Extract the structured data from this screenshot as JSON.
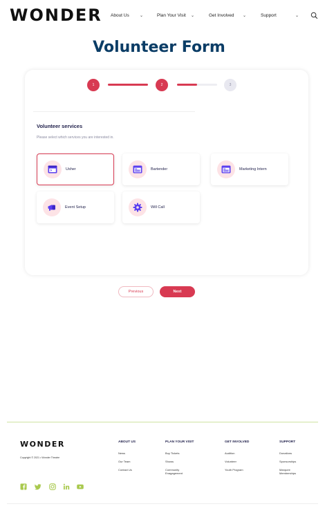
{
  "header": {
    "logo": "WONDER",
    "nav": [
      {
        "label": "About Us"
      },
      {
        "label": "Plan Your Visit"
      },
      {
        "label": "Get Involved"
      },
      {
        "label": "Support"
      }
    ]
  },
  "page_title": "Volunteer Form",
  "stepper": {
    "steps": [
      {
        "number": "1",
        "state": "active"
      },
      {
        "number": "2",
        "state": "active"
      },
      {
        "number": "3",
        "state": "inactive"
      }
    ],
    "connector_progress": [
      1.0,
      0.5
    ]
  },
  "form": {
    "section_title": "Volunteer services",
    "section_subtitle": "Please select which services you are interested in.",
    "services": [
      {
        "label": "Usher",
        "icon": "browser-window-icon",
        "selected": true
      },
      {
        "label": "Bartender",
        "icon": "calendar-window-icon",
        "selected": false
      },
      {
        "label": "Marketing Intern",
        "icon": "calendar-window-icon",
        "selected": false
      },
      {
        "label": "Event Setup",
        "icon": "megaphone-icon",
        "selected": false
      },
      {
        "label": "Will Call",
        "icon": "gear-icon",
        "selected": false
      }
    ]
  },
  "buttons": {
    "previous": "Previous",
    "next": "Next"
  },
  "footer": {
    "logo": "WONDER",
    "copyright": "Copyright © 2021 • Wonder Theatre",
    "columns": [
      {
        "title": "ABOUT US",
        "links": [
          "News",
          "Our Team",
          "Contact Us"
        ]
      },
      {
        "title": "PLAN YOUR VISIT",
        "links": [
          "Buy Tickets",
          "Shows",
          "Community Enagagement"
        ]
      },
      {
        "title": "GET INVOLVED",
        "links": [
          "Audition",
          "Volunteer",
          "Youth Program"
        ]
      },
      {
        "title": "SUPPORT",
        "links": [
          "Donations",
          "Sponsorships",
          "Marquee Memberships"
        ]
      }
    ],
    "social": [
      "facebook-icon",
      "twitter-icon",
      "instagram-icon",
      "linkedin-icon",
      "youtube-icon"
    ]
  },
  "colors": {
    "accent": "#d83a52",
    "title": "#0b3d66",
    "icon_purple": "#5a3ff0",
    "social_green": "#a9c94e"
  }
}
